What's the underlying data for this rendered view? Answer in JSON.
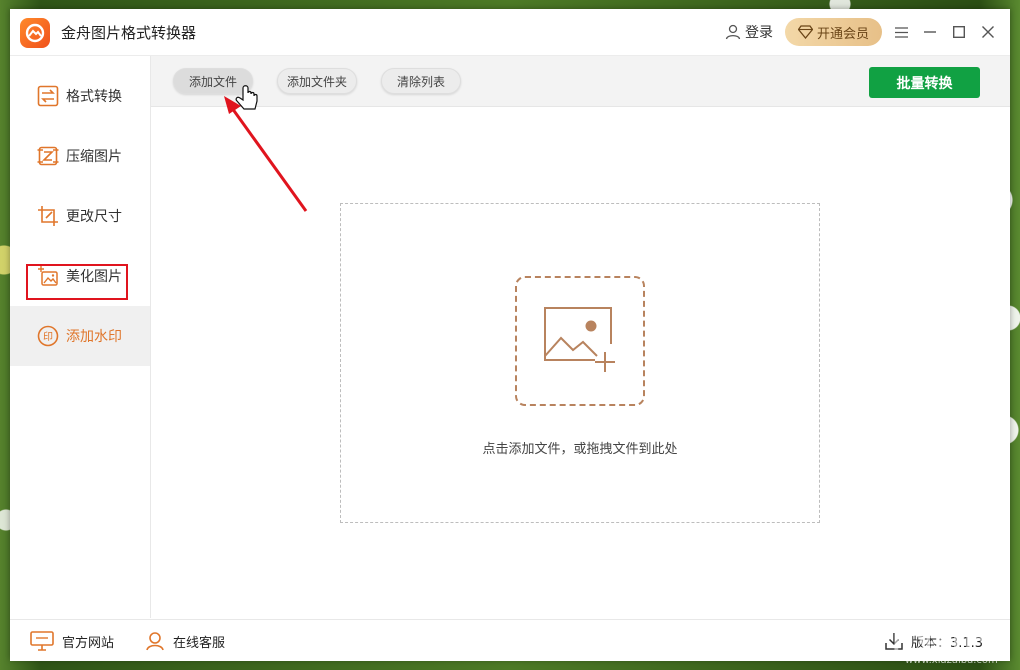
{
  "app": {
    "title": "金舟图片格式转换器",
    "login_label": "登录",
    "vip_label": "开通会员"
  },
  "sidebar": {
    "items": [
      {
        "label": "格式转换",
        "icon": "swap-arrows-icon"
      },
      {
        "label": "压缩图片",
        "icon": "compress-icon"
      },
      {
        "label": "更改尺寸",
        "icon": "resize-crop-icon"
      },
      {
        "label": "美化图片",
        "icon": "beautify-image-icon"
      },
      {
        "label": "添加水印",
        "icon": "watermark-stamp-icon",
        "active": true
      }
    ]
  },
  "toolbar": {
    "add_file": "添加文件",
    "add_folder": "添加文件夹",
    "clear_list": "清除列表",
    "batch_convert": "批量转换"
  },
  "dropzone": {
    "hint": "点击添加文件，或拖拽文件到此处"
  },
  "footer": {
    "website": "官方网站",
    "support": "在线客服",
    "version": "版本：3.1.3"
  },
  "watermark": {
    "main": "下载吧",
    "sub": "www.xiazaiba.com"
  },
  "colors": {
    "accent": "#e0762b",
    "primary_button": "#11a143",
    "highlight_box": "#e0141e",
    "vip_gold": "#e7c088"
  }
}
